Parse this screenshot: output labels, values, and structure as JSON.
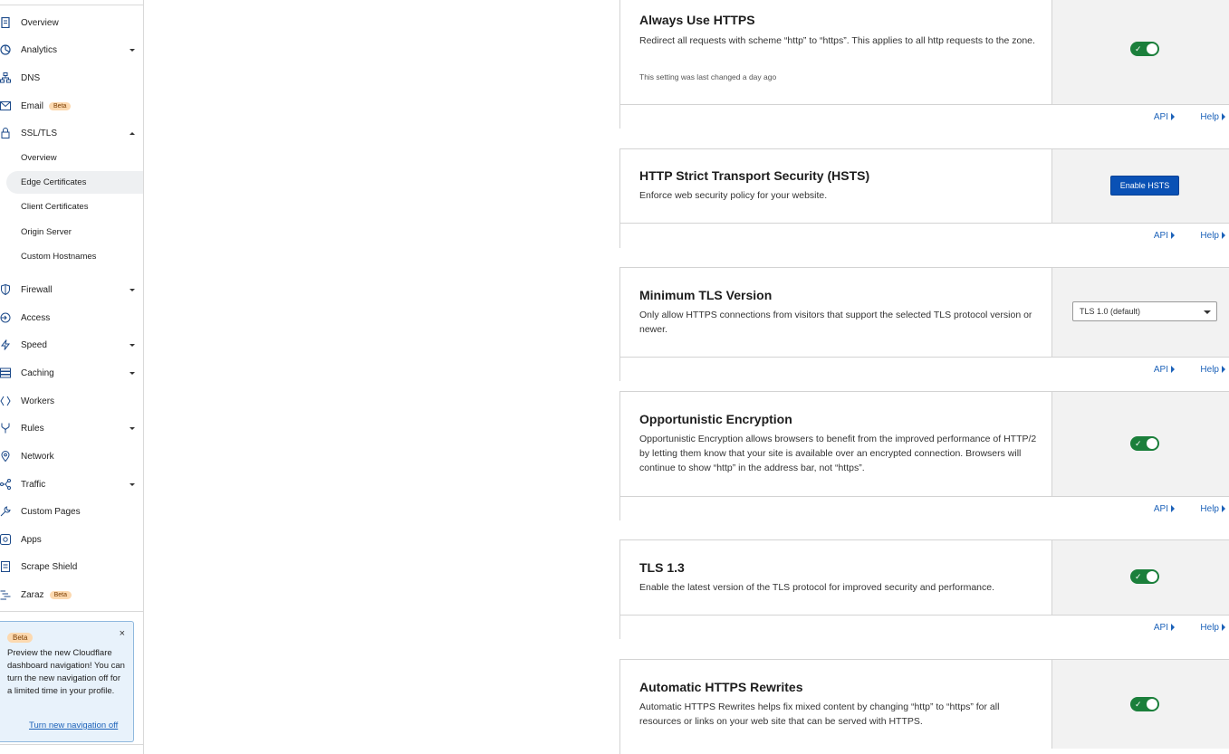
{
  "sidebar": {
    "items": [
      {
        "label": "Overview",
        "icon": "document-icon"
      },
      {
        "label": "Analytics",
        "icon": "clock-chart-icon"
      },
      {
        "label": "DNS",
        "icon": "network-tree-icon"
      },
      {
        "label": "Email",
        "icon": "envelope-icon",
        "badge": "Beta"
      },
      {
        "label": "SSL/TLS",
        "icon": "lock-icon"
      },
      {
        "label": "Firewall",
        "icon": "shield-icon"
      },
      {
        "label": "Access",
        "icon": "access-icon"
      },
      {
        "label": "Speed",
        "icon": "bolt-icon"
      },
      {
        "label": "Caching",
        "icon": "server-stack-icon"
      },
      {
        "label": "Workers",
        "icon": "workers-icon"
      },
      {
        "label": "Rules",
        "icon": "fork-icon"
      },
      {
        "label": "Network",
        "icon": "location-pin-icon"
      },
      {
        "label": "Traffic",
        "icon": "traffic-icon"
      },
      {
        "label": "Custom Pages",
        "icon": "wrench-icon"
      },
      {
        "label": "Apps",
        "icon": "apps-icon"
      },
      {
        "label": "Scrape Shield",
        "icon": "scrape-shield-icon"
      },
      {
        "label": "Zaraz",
        "icon": "zaraz-icon",
        "badge": "Beta"
      }
    ],
    "ssl_sub": [
      {
        "label": "Overview"
      },
      {
        "label": "Edge Certificates"
      },
      {
        "label": "Client Certificates"
      },
      {
        "label": "Origin Server"
      },
      {
        "label": "Custom Hostnames"
      }
    ],
    "beta_notice": {
      "badge": "Beta",
      "close": "×",
      "message": "Preview the new Cloudflare dashboard navigation! You can turn the new navigation off for a limited time in your profile.",
      "link": "Turn new navigation off"
    }
  },
  "cards": [
    {
      "title": "Always Use HTTPS",
      "description": "Redirect all requests with scheme “http” to “https”. This applies to all http requests to the zone.",
      "note": "This setting was last changed a day ago",
      "control": "toggle-on",
      "api": "API",
      "help": "Help"
    },
    {
      "title": "HTTP Strict Transport Security (HSTS)",
      "description": "Enforce web security policy for your website.",
      "control": "button",
      "button_label": "Enable HSTS",
      "api": "API",
      "help": "Help"
    },
    {
      "title": "Minimum TLS Version",
      "description": "Only allow HTTPS connections from visitors that support the selected TLS protocol version or newer.",
      "control": "select",
      "select_value": "TLS 1.0 (default)",
      "api": "API",
      "help": "Help"
    },
    {
      "title": "Opportunistic Encryption",
      "description": "Opportunistic Encryption allows browsers to benefit from the improved performance of HTTP/2 by letting them know that your site is available over an encrypted connection. Browsers will continue to show “http” in the address bar, not “https”.",
      "control": "toggle-on",
      "api": "API",
      "help": "Help"
    },
    {
      "title": "TLS 1.3",
      "description": "Enable the latest version of the TLS protocol for improved security and performance.",
      "control": "toggle-on",
      "api": "API",
      "help": "Help"
    },
    {
      "title": "Automatic HTTPS Rewrites",
      "description": "Automatic HTTPS Rewrites helps fix mixed content by changing “http” to “https” for all resources or links on your web site that can be served with HTTPS.",
      "control": "toggle-on"
    }
  ],
  "colors": {
    "toggle_on": "#1b7f3b",
    "link": "#1c62b9",
    "primary_button": "#0a51b5",
    "beta_badge": "#fcd9b0",
    "notice_bg": "#e8f2fb"
  }
}
